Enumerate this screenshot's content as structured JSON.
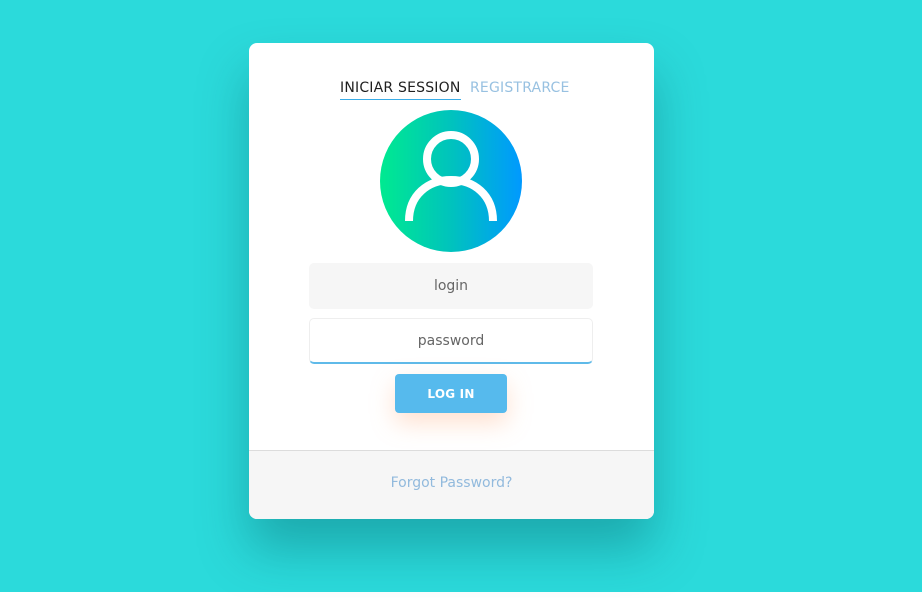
{
  "tabs": {
    "signin_label": "INICIAR SESSION",
    "register_label": "REGISTRARCE"
  },
  "avatar": {
    "icon": "user-icon",
    "gradient_colors": [
      "#00ea90",
      "#0099ff"
    ]
  },
  "form": {
    "login_placeholder": "login",
    "password_placeholder": "password",
    "submit_label": "LOG IN"
  },
  "footer": {
    "forgot_label": "Forgot Password?"
  },
  "colors": {
    "background": "#2bdadb",
    "accent": "#56baed",
    "link": "#92badd"
  }
}
